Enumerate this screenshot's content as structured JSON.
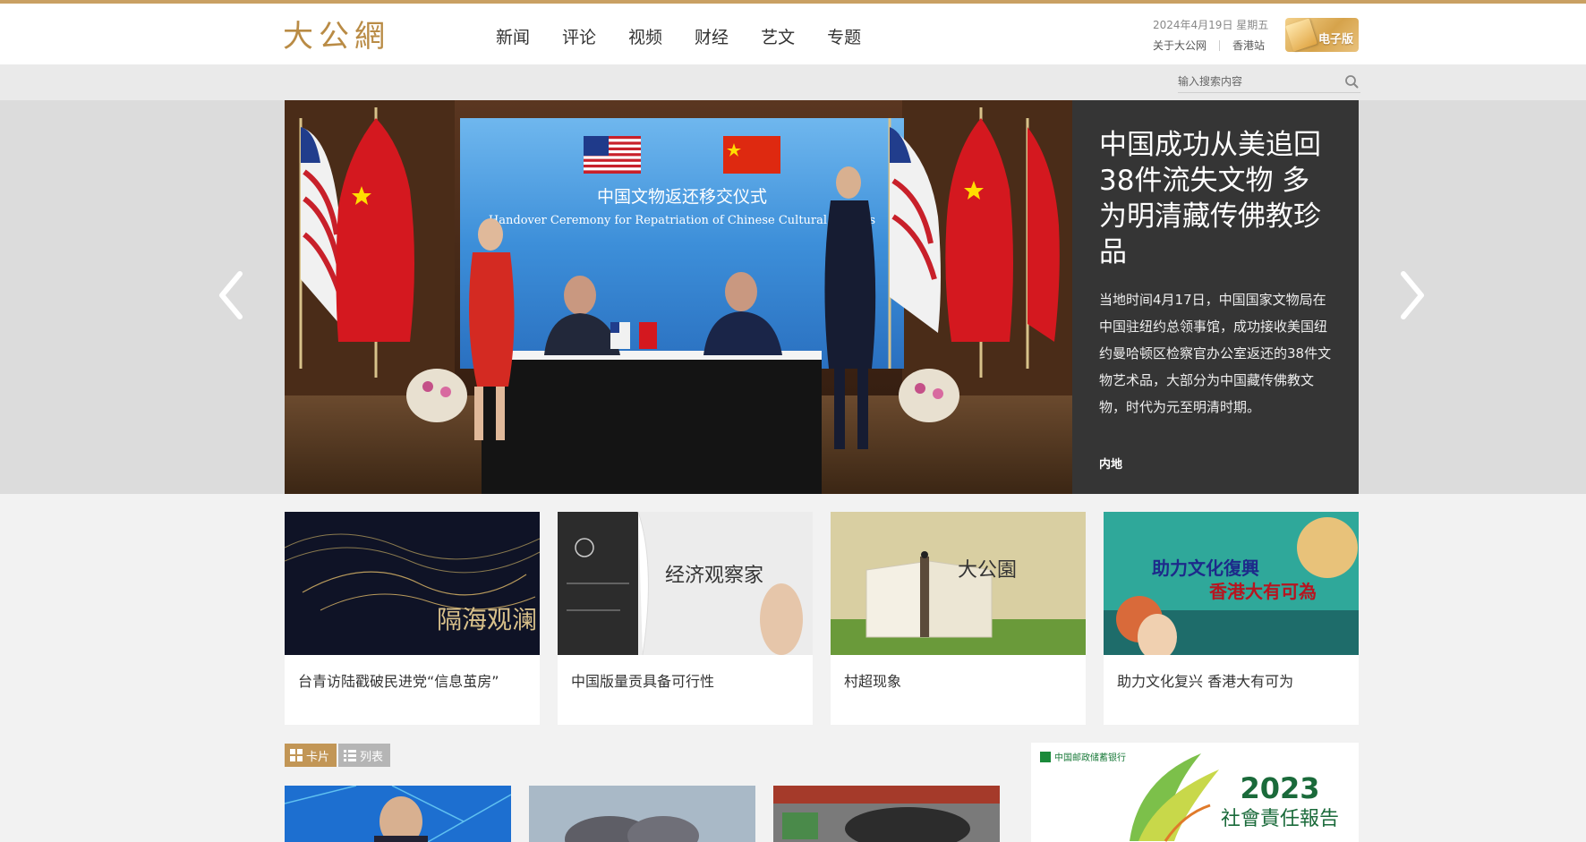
{
  "header": {
    "logo_text": "大公網",
    "nav": [
      "新闻",
      "评论",
      "视频",
      "财经",
      "艺文",
      "专题"
    ],
    "date": "2024年4月19日 星期五",
    "links": [
      "关于大公网",
      "香港站"
    ],
    "epaper_label": "电子版"
  },
  "search": {
    "placeholder": "输入搜索内容"
  },
  "hero": {
    "title": "中国成功从美追回38件流失文物 多为明清藏传佛教珍品",
    "description": "当地时间4月17日，中国国家文物局在中国驻纽约总领事馆，成功接收美国纽约曼哈顿区检察官办公室返还的38件文物艺术品，大部分为中国藏传佛教文物，时代为元至明清时期。",
    "tag": "内地",
    "screen_title_cn": "中国文物返还移交仪式",
    "screen_title_en": "Handover Ceremony for Repatriation of Chinese Cultural Objects"
  },
  "cards": [
    {
      "title": "台青访陆戳破民进党“信息茧房”",
      "image_text": "隔海观澜"
    },
    {
      "title": "中国版量贡具备可行性",
      "image_text": "经济观察家"
    },
    {
      "title": "村超现象",
      "image_text": "大公園"
    },
    {
      "title": "助力文化复兴 香港大有可为",
      "image_text_1": "助力文化復興",
      "image_text_2": "香港大有可為"
    }
  ],
  "view_toggle": {
    "card_label": "卡片",
    "list_label": "列表"
  },
  "ad": {
    "bank_name": "中国邮政储蓄银行",
    "year": "2023",
    "subtitle": "社會責任報告"
  },
  "colors": {
    "accent": "#c29656",
    "hero_panel": "#353535"
  }
}
